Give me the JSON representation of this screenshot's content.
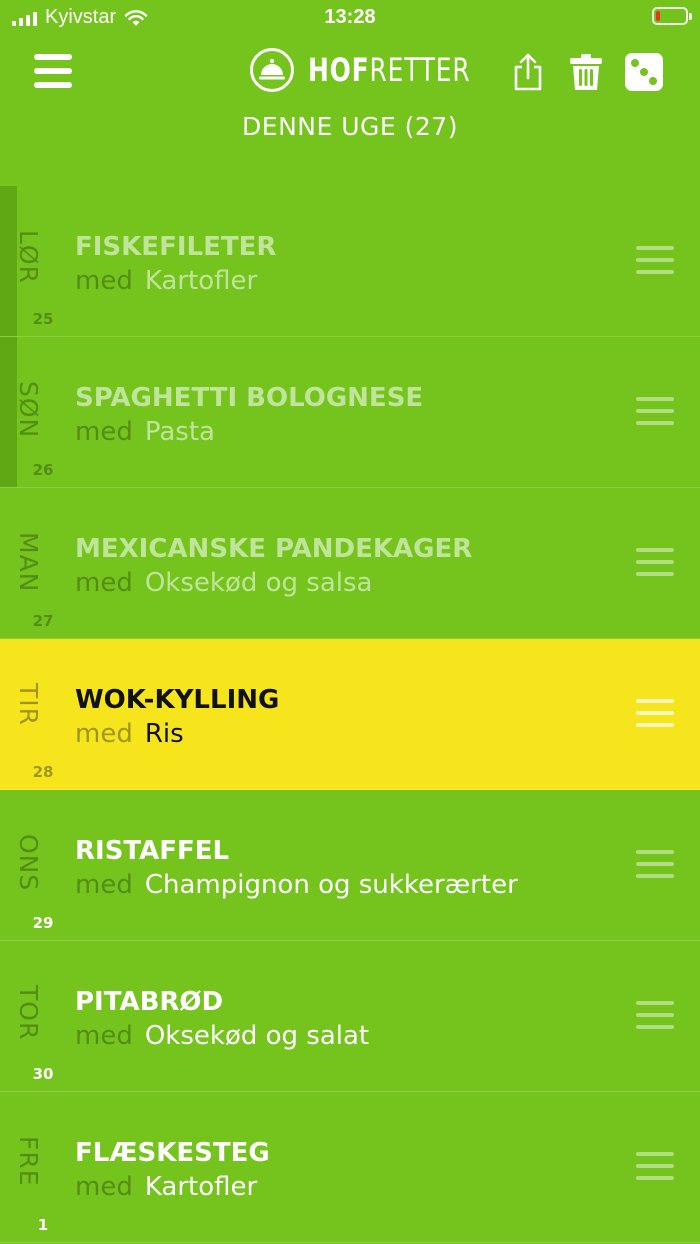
{
  "status": {
    "carrier": "Kyivstar",
    "time": "13:28",
    "battery_level": 0.15
  },
  "header": {
    "logo_bold": "HOF",
    "logo_light": "RETTER",
    "subtitle": "DENNE UGE (27)",
    "icons": [
      "menu-icon",
      "share-icon",
      "trash-icon",
      "dice-icon"
    ]
  },
  "days": [
    {
      "day": "LØR",
      "num": "25",
      "title": "FISKEFILETER",
      "med": "med",
      "side": "Kartofler",
      "state": "past"
    },
    {
      "day": "SØN",
      "num": "26",
      "title": "SPAGHETTI BOLOGNESE",
      "med": "med",
      "side": "Pasta",
      "state": "past"
    },
    {
      "day": "MAN",
      "num": "27",
      "title": "MEXICANSKE PANDEKAGER",
      "med": "med",
      "side": "Oksekød og salsa",
      "state": "dim"
    },
    {
      "day": "TIR",
      "num": "28",
      "title": "WOK-KYLLING",
      "med": "med",
      "side": "Ris",
      "state": "today"
    },
    {
      "day": "ONS",
      "num": "29",
      "title": "RISTAFFEL",
      "med": "med",
      "side": "Champignon og sukkerærter",
      "state": "future"
    },
    {
      "day": "TOR",
      "num": "30",
      "title": "PITABRØD",
      "med": "med",
      "side": "Oksekød og salat",
      "state": "future"
    },
    {
      "day": "FRE",
      "num": "1",
      "title": "FLÆSKESTEG",
      "med": "med",
      "side": "Kartofler",
      "state": "future"
    }
  ],
  "colors": {
    "background": "#74c41d",
    "today": "#f6e51d",
    "past_accent": "#60a915",
    "battery_low": "#e8341c"
  }
}
